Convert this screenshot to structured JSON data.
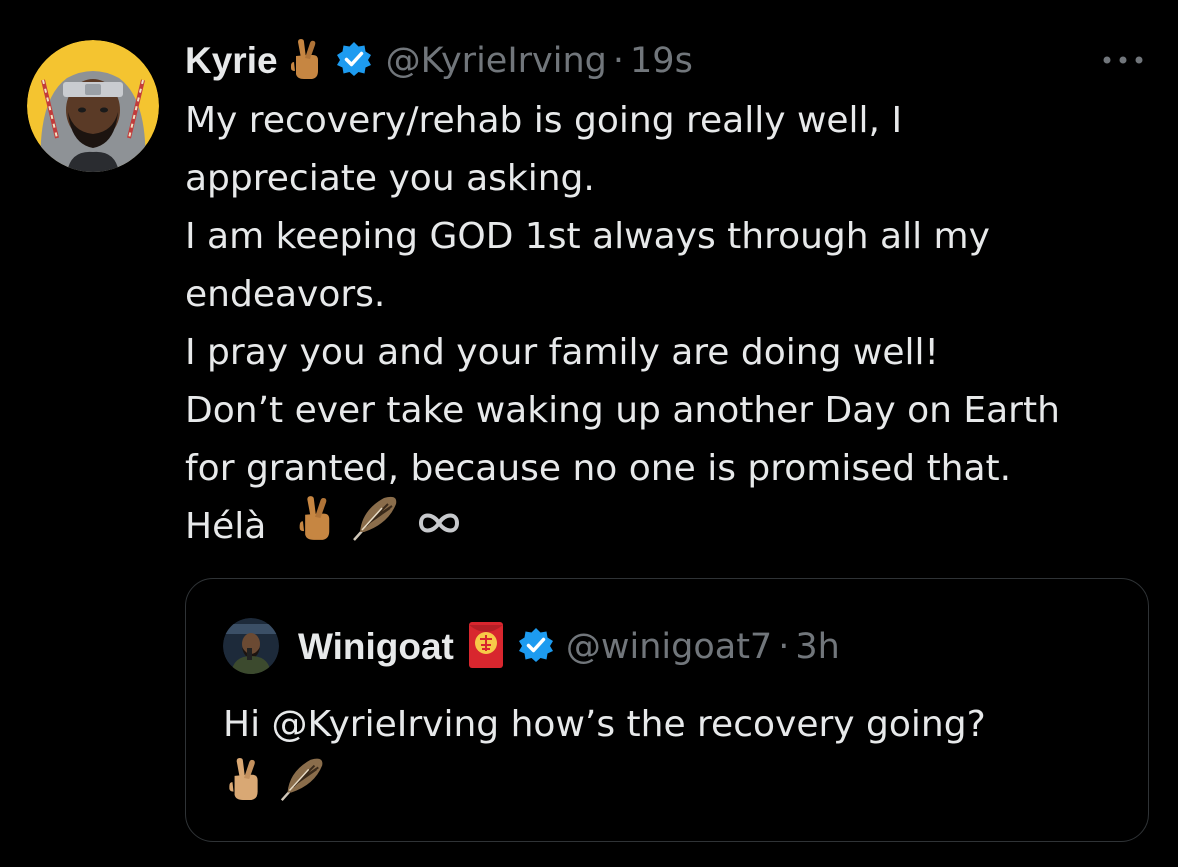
{
  "author": {
    "name": "Kyrie",
    "handle": "@KyrieIrving",
    "separator": "·",
    "time": "19s",
    "verified_color": "#1d9bf0"
  },
  "tweet": {
    "lines": [
      "My recovery/rehab is going really well, I",
      "appreciate you asking.",
      "I am keeping GOD 1st always through all my",
      "endeavors.",
      "I pray you and your family are doing well!",
      "Don’t ever take waking up another Day on Earth",
      "for granted, because no one is promised that."
    ],
    "signoff": "Hélà",
    "signoff_icons": [
      "crossed-fingers-icon",
      "feather-icon",
      "infinity-icon"
    ]
  },
  "quoted": {
    "name": "Winigoat",
    "handle": "@winigoat7",
    "separator": "·",
    "time": "3h",
    "text": "Hi @KyrieIrving how’s the recovery going?",
    "icons": [
      "crossed-fingers-icon",
      "feather-icon"
    ]
  },
  "colors": {
    "background": "#000000",
    "text": "#e7e9ea",
    "secondary": "#71767b",
    "border": "#2f3336",
    "avatar_bg": "#f4c430"
  }
}
